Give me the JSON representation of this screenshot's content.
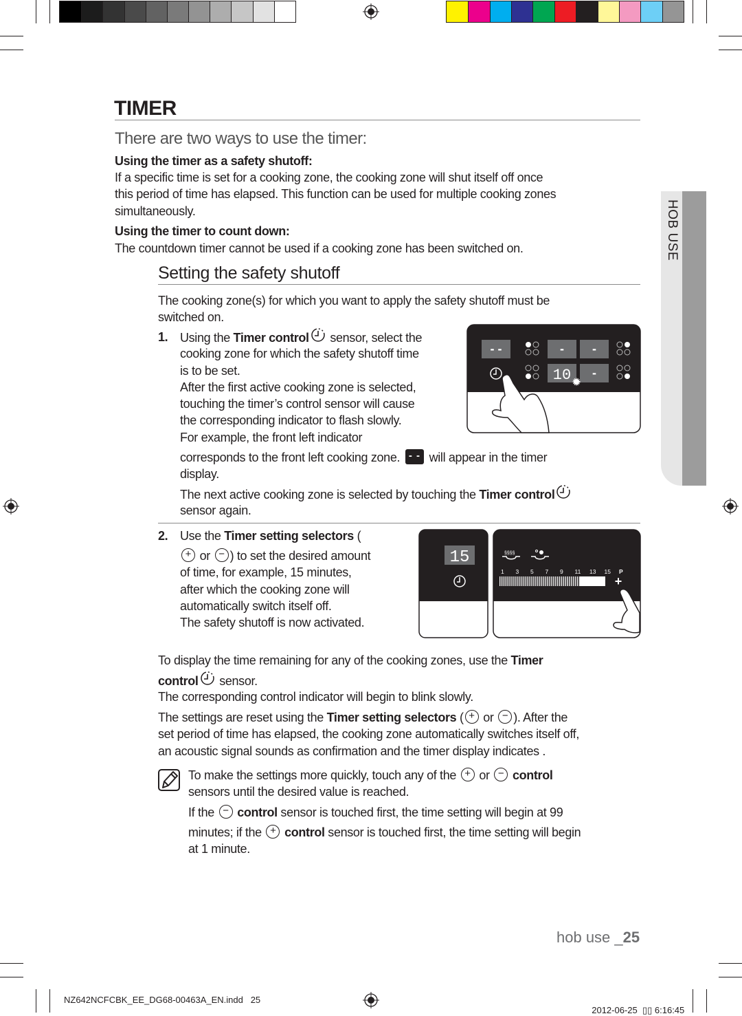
{
  "colors": {
    "grayscale": [
      "#000000",
      "#1c1c1c",
      "#333333",
      "#4a4a4a",
      "#626262",
      "#7a7a7a",
      "#939393",
      "#adadad",
      "#c6c6c6",
      "#e2e2e2",
      "#ffffff"
    ],
    "process": [
      "#fff200",
      "#ec008c",
      "#00aeef",
      "#2e3192",
      "#00a651",
      "#ed1c24",
      "#231f20",
      "#fff799",
      "#f49ac1",
      "#6dcff6",
      "#959595"
    ],
    "side_tab": "#e6e6e6",
    "side_strip": "#9c9c9c",
    "text": "#231f20"
  },
  "header": {
    "title": "TIMER",
    "subtitle": "There are two ways to use the timer:"
  },
  "side_tab": {
    "label": "HOB USE"
  },
  "sections": {
    "safety_heading": "Using the timer as a safety shutoff:",
    "safety_text": [
      [
        "If a specific time is set for a cooking zone, the cooking zone will shut itself off once"
      ],
      [
        "this period of time has elapsed. This function can be used for multiple cooking zones"
      ],
      [
        "simultaneously."
      ]
    ],
    "count_heading": "Using the timer to count down:",
    "count_text": [
      [
        "The countdown timer cannot be used if a cooking zone has been switched on."
      ]
    ]
  },
  "setting": {
    "title": "Setting the safety shutoff",
    "intro": [
      [
        "The cooking zone(s) for which you want to apply the safety shutoff must be"
      ],
      [
        "switched on."
      ]
    ],
    "step1_number": "1.",
    "step1_a": [
      [
        "Using the ",
        {
          "b": "Timer control"
        },
        {
          "icon": "timer"
        },
        " sensor, select the"
      ],
      [
        "cooking zone for which the safety shutoff time"
      ],
      [
        "is to be set."
      ],
      [
        "After the first active cooking zone is selected,"
      ],
      [
        "touching the timer’s control sensor will cause"
      ],
      [
        "the corresponding indicator to flash slowly."
      ],
      [
        "For example, the front left indicator"
      ]
    ],
    "step1_b": [
      [
        "corresponds to the front left cooking zone. ",
        {
          "box": "- -"
        },
        " will appear in the timer"
      ],
      [
        "display."
      ]
    ],
    "step1_c": [
      [
        "The next active cooking zone is selected by touching the ",
        {
          "b": "Timer control"
        },
        {
          "icon": "timer"
        }
      ],
      [
        "sensor again."
      ]
    ],
    "step2_number": "2.",
    "step2_a": [
      [
        "Use the ",
        {
          "b": "Timer setting selectors"
        },
        " ("
      ]
    ],
    "step2_b": [
      [
        {
          "icon": "plus"
        },
        " or ",
        {
          "icon": "minus"
        },
        ") to set the desired amount"
      ],
      [
        "of time, for example, 15 minutes,"
      ],
      [
        "after which the cooking zone will"
      ],
      [
        "automatically switch itself off."
      ],
      [
        "The safety shutoff is now activated."
      ]
    ]
  },
  "display": {
    "line1": [
      [
        "To display the time remaining for any of the cooking zones, use the ",
        {
          "b": "Timer"
        }
      ]
    ],
    "line2": [
      [
        {
          "b": "control"
        },
        {
          "icon": "timer"
        },
        " sensor."
      ]
    ],
    "line3": [
      [
        "The corresponding control indicator will begin to blink slowly."
      ]
    ],
    "reset": [
      [
        "The settings are reset using the ",
        {
          "b": "Timer setting selectors"
        },
        " (",
        {
          "icon": "plus"
        },
        " or ",
        {
          "icon": "minus"
        },
        "). After the"
      ],
      [
        "set period of time has elapsed, the cooking zone automatically switches itself off,"
      ],
      [
        "an acoustic signal sounds as confirmation and the timer display indicates ."
      ]
    ]
  },
  "note": {
    "icon": "note-pencil-icon",
    "a": [
      [
        "To make the settings more quickly, touch any of the ",
        {
          "icon": "plus"
        },
        " or ",
        {
          "icon": "minus"
        },
        " ",
        {
          "b": "control"
        }
      ],
      [
        "sensors until the desired value is reached."
      ]
    ],
    "b": [
      [
        "If the ",
        {
          "icon": "minus"
        },
        " ",
        {
          "b": "control"
        },
        " sensor is touched first, the time setting will begin at 99"
      ]
    ],
    "c": [
      [
        "minutes; if the ",
        {
          "icon": "plus"
        },
        " ",
        {
          "b": "control"
        },
        " sensor is touched first, the time setting will begin"
      ],
      [
        "at 1 minute."
      ]
    ]
  },
  "illustration1": {
    "display_value": "10",
    "dash_double": "- -",
    "dash": "-"
  },
  "illustration2": {
    "display_value": "15",
    "scale": [
      "1",
      "3",
      "5",
      "7",
      "9",
      "11",
      "13",
      "15",
      "P"
    ],
    "plus": "+"
  },
  "footer": {
    "section": "hob use _",
    "page": "25",
    "file": "NZ642NCFCBK_EE_DG68-00463A_EN.indd   25",
    "date": "2012-06-25",
    "time": "▯▯ 6:16:45"
  }
}
